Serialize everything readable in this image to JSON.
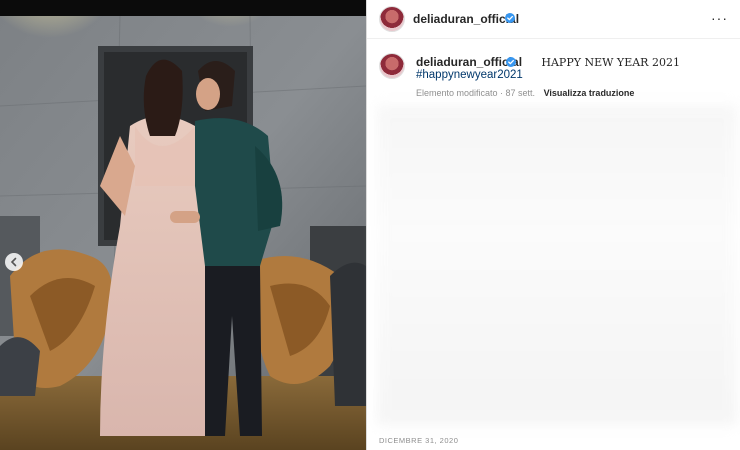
{
  "post": {
    "username": "deliaduran_official",
    "caption": "HAPPY NEW YEAR 2021",
    "hashtag": "#happynewyear2021",
    "edited_label": "Elemento modificato · 87 sett.",
    "translate_label": "Visualizza traduzione",
    "date": "DICEMBRE 31, 2020",
    "more_icon": "···"
  },
  "colors": {
    "verified": "#3897f0",
    "link": "#00376b",
    "muted": "#8e8e8e"
  },
  "icons": {
    "verified": "verified-badge-icon",
    "more": "more-options-icon",
    "prev": "chevron-left-icon"
  }
}
